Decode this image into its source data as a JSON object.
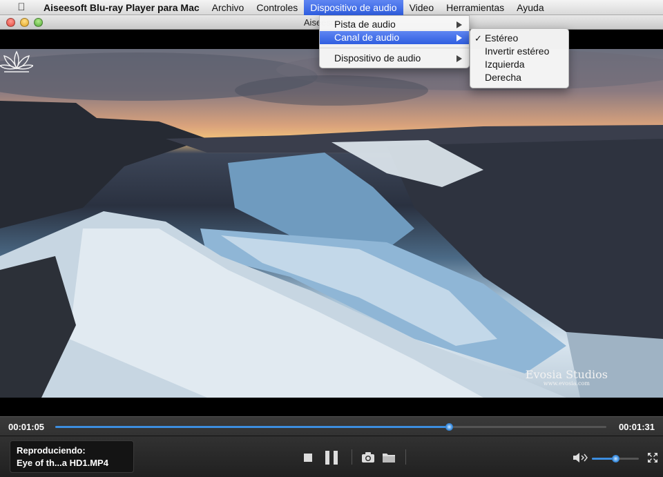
{
  "menubar": {
    "apple_icon": "apple-icon",
    "app_name": "Aiseesoft Blu-ray Player para Mac",
    "items": [
      "Archivo",
      "Controles",
      "Dispositivo de audio",
      "Video",
      "Herramientas",
      "Ayuda"
    ],
    "active": "Dispositivo de audio",
    "highlight_color": "#2f5ee0"
  },
  "window": {
    "title": "Aiseesoft Blu-"
  },
  "audio_menu": {
    "items": [
      {
        "label": "Pista de audio",
        "submenu": true
      },
      {
        "label": "Canal de audio",
        "submenu": true,
        "highlighted": true
      },
      {
        "label": "Dispositivo de audio",
        "submenu": true
      }
    ]
  },
  "channel_submenu": {
    "items": [
      {
        "label": "Estéreo",
        "checked": true
      },
      {
        "label": "Invertir estéreo",
        "checked": false
      },
      {
        "label": "Izquierda",
        "checked": false
      },
      {
        "label": "Derecha",
        "checked": false
      }
    ]
  },
  "video": {
    "watermark_title": "Evosia Studios",
    "watermark_url": "www.evosia.com"
  },
  "controls": {
    "elapsed": "00:01:05",
    "duration": "00:01:31",
    "progress_fraction": 0.714,
    "now_playing_label": "Reproduciendo:",
    "now_playing_file": "Eye of th...a HD1.MP4",
    "volume_fraction": 0.5,
    "accent_color": "#3c8ee0"
  }
}
